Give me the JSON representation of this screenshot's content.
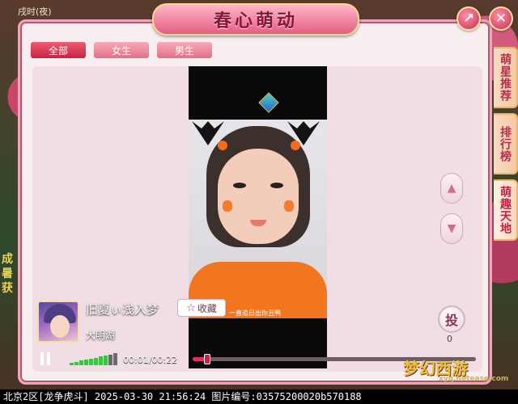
{
  "top_time": "戌时(夜)",
  "window": {
    "title": "春心萌动",
    "share_icon": "share-arrow-icon",
    "close_icon": "close-icon"
  },
  "filter_tabs": [
    {
      "label": "全部",
      "active": true
    },
    {
      "label": "女生",
      "active": false
    },
    {
      "label": "男生",
      "active": false
    }
  ],
  "side_tabs": [
    {
      "label": "萌星推荐",
      "active": false
    },
    {
      "label": "排行榜",
      "active": false
    },
    {
      "label": "萌趣天地",
      "active": true
    }
  ],
  "video": {
    "title": "旧夏ぃ浅入梦",
    "author": "大明湖",
    "collect_label": "收藏",
    "overlay_text": "一直追日出你丑鸭",
    "current_time": "00:01",
    "total_time": "00:22",
    "time_display": "00:01/00:22",
    "progress": 0.05,
    "volume_level": 0.8
  },
  "vote": {
    "label": "投",
    "count": "0"
  },
  "side_fragments": [
    "成",
    "暑",
    "获"
  ],
  "watermark": {
    "logo": "梦幻西游",
    "url": "xyq.netease.com"
  },
  "status_bar": "北京2区[龙争虎斗] 2025-03-30 21:56:24 图片编号:03575200020b570188",
  "colors": {
    "accent": "#e0325c",
    "title_text": "#8b1239",
    "tab_active": "#c8233f",
    "volume": "#40c245"
  }
}
